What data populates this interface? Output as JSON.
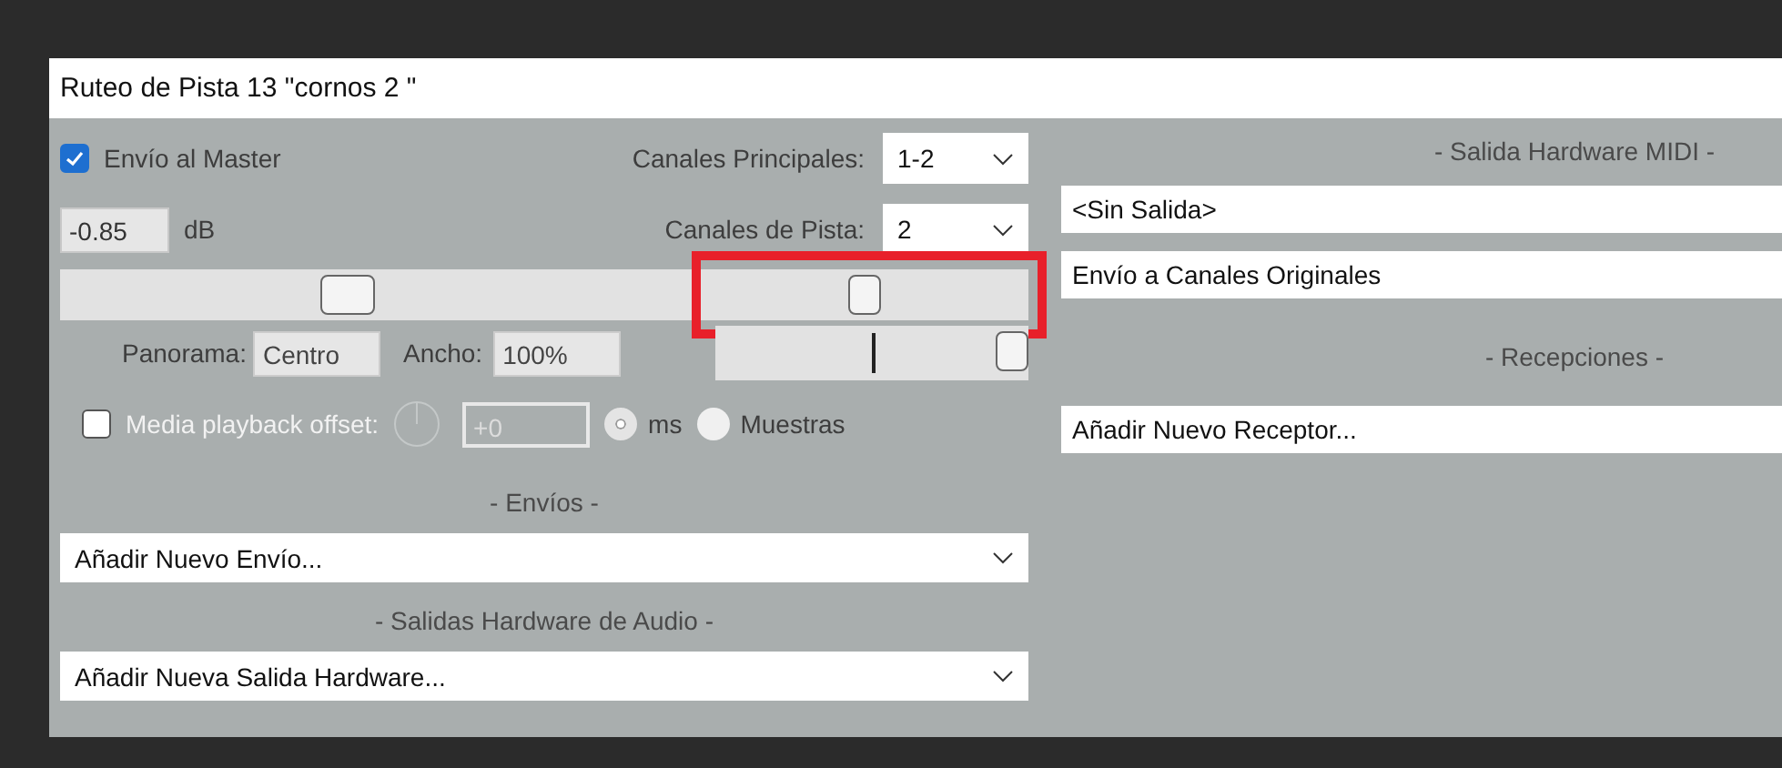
{
  "window": {
    "title": "Ruteo de Pista 13 \"cornos 2 \""
  },
  "master_send": {
    "label": "Envío al Master",
    "checked": true
  },
  "main_channels": {
    "label": "Canales Principales:",
    "value": "1-2"
  },
  "volume": {
    "value": "-0.85",
    "unit": "dB",
    "level": 0.45
  },
  "track_channels": {
    "label": "Canales de Pista:",
    "value": "2"
  },
  "pan": {
    "level": 0.5,
    "highlighted": true
  },
  "panorama": {
    "label": "Panorama:",
    "value": "Centro"
  },
  "width": {
    "label": "Ancho:",
    "value": "100%",
    "level": 1
  },
  "media_offset": {
    "label": "Media playback offset:",
    "checked": false,
    "disabled": true,
    "value": "+0"
  },
  "units": [
    {
      "label": "ms",
      "selected": true
    },
    {
      "label": "Muestras",
      "selected": false
    }
  ],
  "sends": {
    "heading": "- Envíos -",
    "dropdown": "Añadir Nuevo Envío..."
  },
  "audio_outputs": {
    "heading": "- Salidas Hardware de Audio -",
    "dropdown": "Añadir Nueva Salida Hardware..."
  },
  "midi_output": {
    "heading": "- Salida Hardware MIDI -",
    "fields": [
      "<Sin Salida>",
      "Envío a Canales Originales"
    ]
  },
  "receives": {
    "heading": "- Recepciones -",
    "dropdown": "Añadir Nuevo Receptor..."
  }
}
